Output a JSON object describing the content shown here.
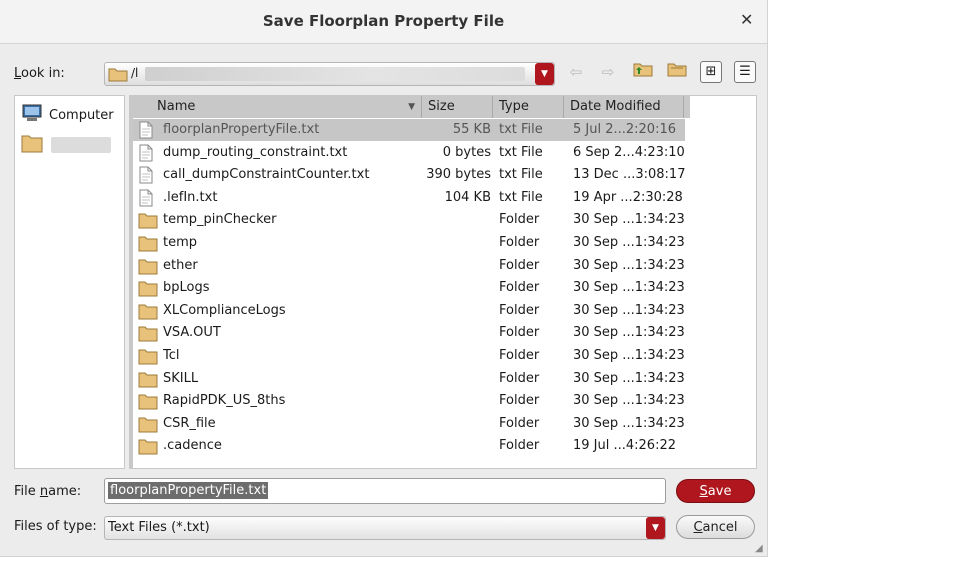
{
  "window": {
    "title": "Save Floorplan Property File"
  },
  "lookin": {
    "label_pre": "",
    "label_ul": "L",
    "label_post": "ook in:",
    "path": "/l"
  },
  "sidebar": {
    "items": [
      {
        "label": "Computer",
        "icon": "computer-icon"
      },
      {
        "label": "",
        "icon": "folder-icon"
      }
    ]
  },
  "columns": [
    "Name",
    "Size",
    "Type",
    "Date Modified"
  ],
  "files": [
    {
      "name": "floorplanPropertyFile.txt",
      "size": "55 KB",
      "type": "txt File",
      "date": "5 Jul 2...2:20:16",
      "kind": "file",
      "selected": true
    },
    {
      "name": "dump_routing_constraint.txt",
      "size": "0 bytes",
      "type": "txt File",
      "date": "6 Sep 2...4:23:10",
      "kind": "file"
    },
    {
      "name": "call_dumpConstraintCounter.txt",
      "size": "390 bytes",
      "type": "txt File",
      "date": "13 Dec ...3:08:17",
      "kind": "file"
    },
    {
      "name": ".lefIn.txt",
      "size": "104 KB",
      "type": "txt File",
      "date": "19 Apr ...2:30:28",
      "kind": "file"
    },
    {
      "name": "temp_pinChecker",
      "size": "",
      "type": "Folder",
      "date": "30 Sep ...1:34:23",
      "kind": "folder"
    },
    {
      "name": "temp",
      "size": "",
      "type": "Folder",
      "date": "30 Sep ...1:34:23",
      "kind": "folder"
    },
    {
      "name": "ether",
      "size": "",
      "type": "Folder",
      "date": "30 Sep ...1:34:23",
      "kind": "folder"
    },
    {
      "name": "bpLogs",
      "size": "",
      "type": "Folder",
      "date": "30 Sep ...1:34:23",
      "kind": "folder"
    },
    {
      "name": "XLComplianceLogs",
      "size": "",
      "type": "Folder",
      "date": "30 Sep ...1:34:23",
      "kind": "folder"
    },
    {
      "name": "VSA.OUT",
      "size": "",
      "type": "Folder",
      "date": "30 Sep ...1:34:23",
      "kind": "folder"
    },
    {
      "name": "Tcl",
      "size": "",
      "type": "Folder",
      "date": "30 Sep ...1:34:23",
      "kind": "folder"
    },
    {
      "name": "SKILL",
      "size": "",
      "type": "Folder",
      "date": "30 Sep ...1:34:23",
      "kind": "folder"
    },
    {
      "name": "RapidPDK_US_8ths",
      "size": "",
      "type": "Folder",
      "date": "30 Sep ...1:34:23",
      "kind": "folder"
    },
    {
      "name": "CSR_file",
      "size": "",
      "type": "Folder",
      "date": "30 Sep ...1:34:23",
      "kind": "folder"
    },
    {
      "name": ".cadence",
      "size": "",
      "type": "Folder",
      "date": "19 Jul ...4:26:22",
      "kind": "folder"
    }
  ],
  "filename": {
    "label_pre": "File ",
    "label_ul": "n",
    "label_post": "ame:",
    "value": "floorplanPropertyFile.txt"
  },
  "filetype": {
    "label": "Files of type:",
    "value": "Text Files (*.txt)"
  },
  "buttons": {
    "save_ul": "S",
    "save_rest": "ave",
    "cancel_ul": "C",
    "cancel_rest": "ancel"
  },
  "colors": {
    "accent": "#b0161d",
    "selected_row": "#c6c6c6",
    "header_bg": "#c8c8c8",
    "folder": "#e8c27a"
  }
}
